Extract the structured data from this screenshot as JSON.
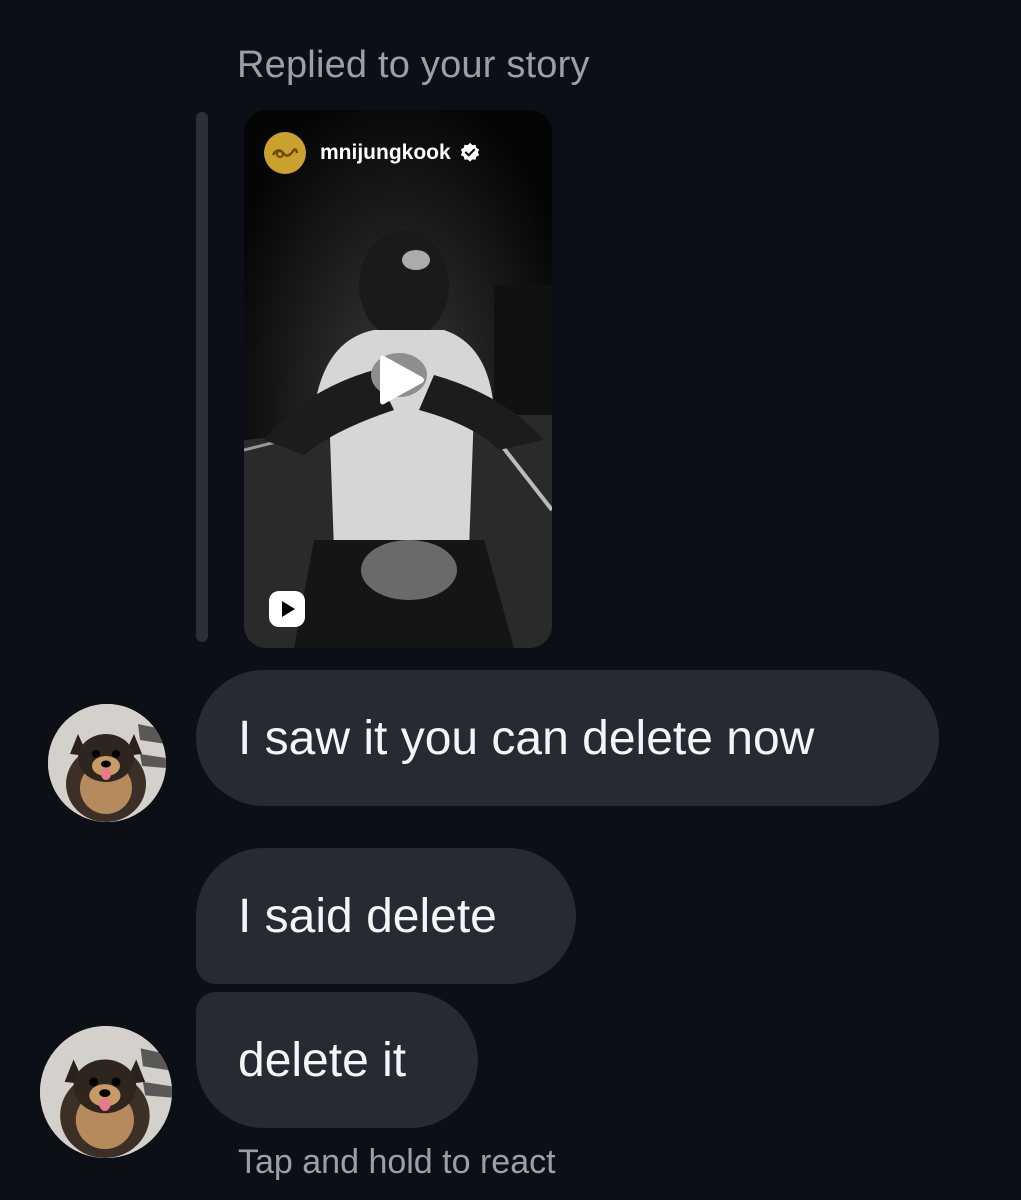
{
  "story": {
    "reply_label": "Replied to your story",
    "username": "mnijungkook",
    "verified": true,
    "media_type": "reel"
  },
  "messages": [
    {
      "text": "I saw it you can delete now",
      "avatar": "pomeranian-avatar"
    },
    {
      "text": "I said delete"
    },
    {
      "text": "delete it",
      "avatar": "pomeranian-avatar"
    }
  ],
  "footer": {
    "hint": "Tap and hold to react"
  },
  "colors": {
    "background": "#0c0f16",
    "bubble": "#262a33",
    "muted_text": "#9aa0ab",
    "story_avatar": "#c9a12c"
  },
  "icons": [
    "play-icon",
    "reel-icon",
    "verified-badge-icon"
  ]
}
